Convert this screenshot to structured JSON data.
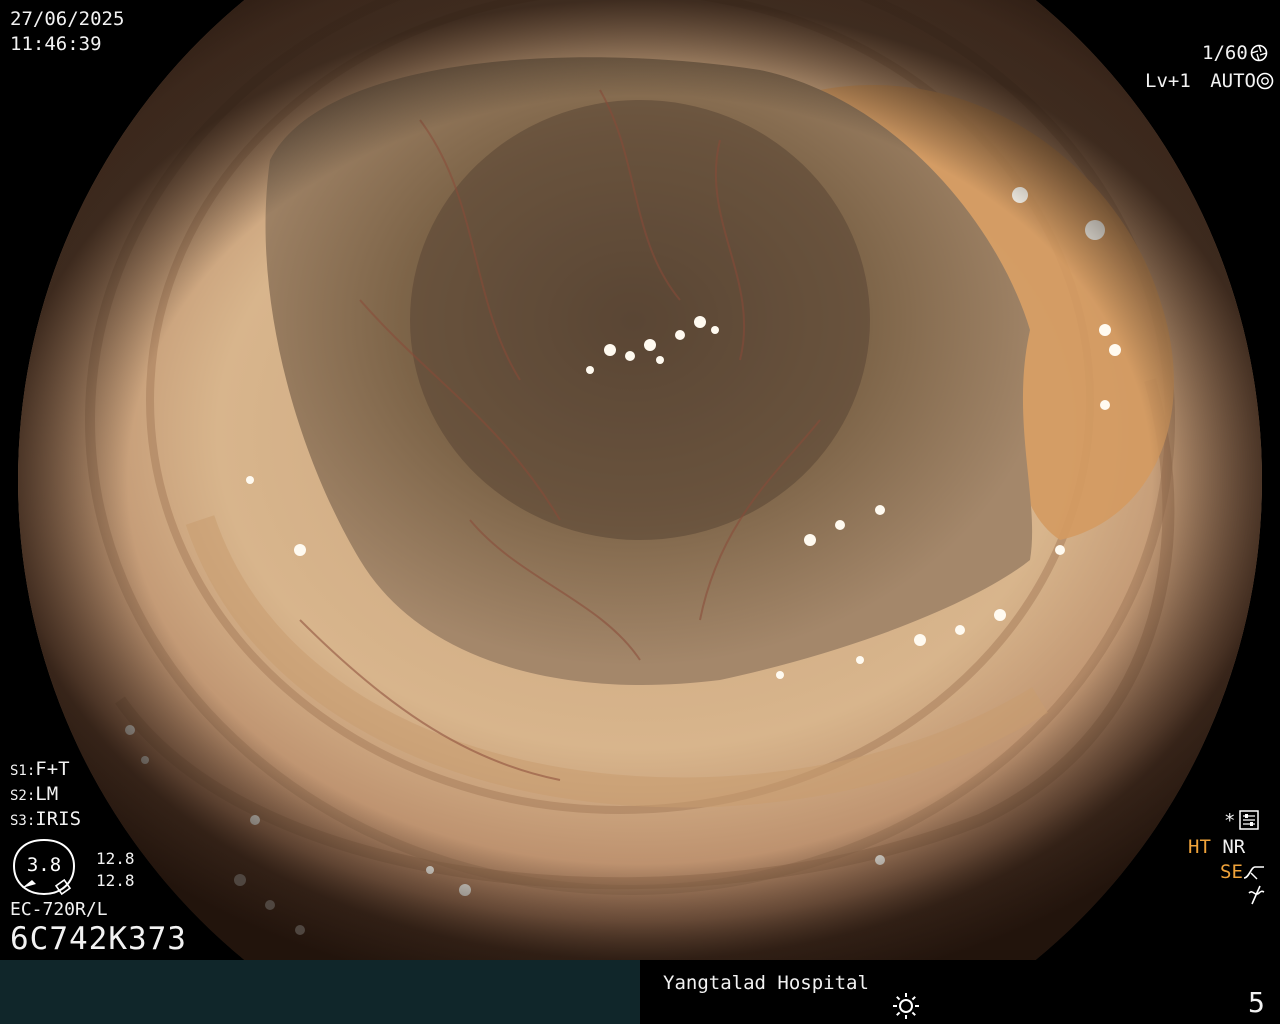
{
  "datetime": {
    "date": "27/06/2025",
    "time": "11:46:39"
  },
  "settings": {
    "s1_key": "S1:",
    "s1_value": "F+T",
    "s2_key": "S2:",
    "s2_value": "LM",
    "s3_key": "S3:",
    "s3_value": "IRIS"
  },
  "gauge": {
    "value": "3.8",
    "upper": "12.8",
    "lower": "12.8"
  },
  "scope": {
    "model": "EC-720R/L",
    "serial": "6C742K373"
  },
  "exposure": {
    "shutter": "1/60",
    "level": "Lv+1",
    "mode": "AUTO"
  },
  "modes": {
    "ht": "HT",
    "nr": "NR",
    "se": "SE",
    "asterisk": "*"
  },
  "footer": {
    "hospital": "Yangtalad Hospital",
    "page_number": "5"
  },
  "colors": {
    "orange": "#f0a33a",
    "footer_bg": "#10262a"
  },
  "icons": [
    "aperture-icon",
    "auto-iris-icon",
    "menu-icon",
    "enhance-icon",
    "no-flicker-icon",
    "light-icon"
  ]
}
